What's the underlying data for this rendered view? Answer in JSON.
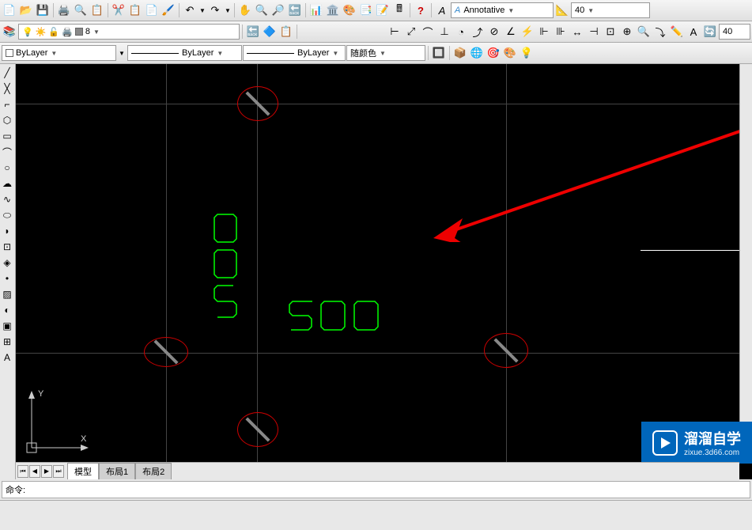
{
  "toolbar": {
    "annotation_style": "Annotative",
    "annotation_scale": "40",
    "dim_value": "40"
  },
  "layers": {
    "current_layer": "8",
    "linetype": "ByLayer",
    "lineweight": "ByLayer",
    "plot_style": "ByLayer",
    "color_label": "随颜色"
  },
  "canvas": {
    "dim_horizontal": "500",
    "dim_vertical": "500",
    "ucs_x": "X",
    "ucs_y": "Y"
  },
  "tabs": {
    "model": "模型",
    "layout1": "布局1",
    "layout2": "布局2"
  },
  "command": {
    "prompt": "命令:"
  },
  "watermark": {
    "title": "溜溜自学",
    "url": "zixue.3d66.com"
  }
}
